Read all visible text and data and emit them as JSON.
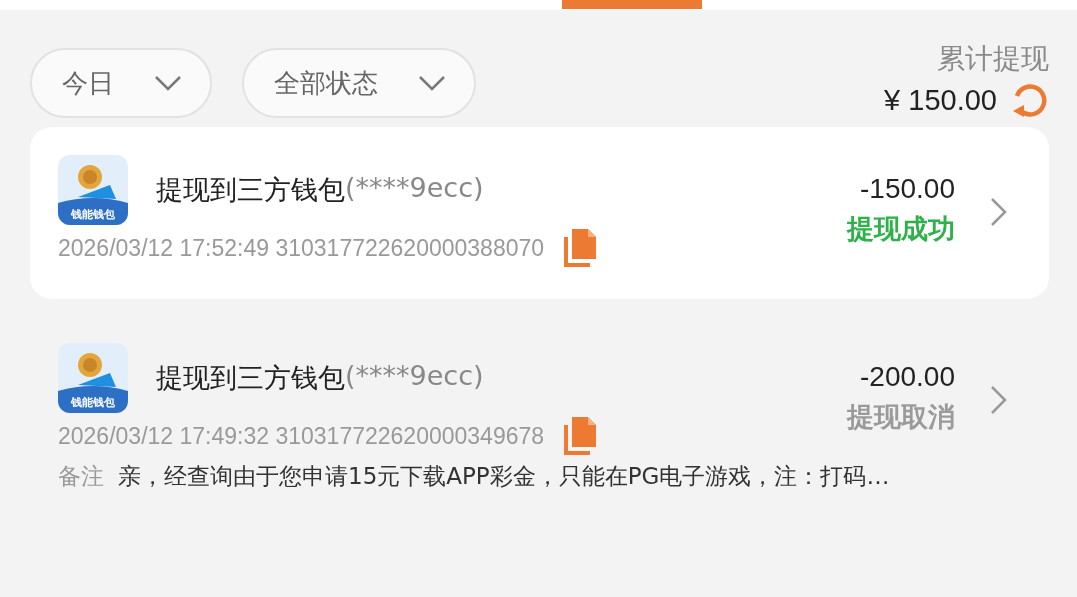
{
  "filters": [
    {
      "label": "今日"
    },
    {
      "label": "全部状态"
    }
  ],
  "summary": {
    "label": "累计提现",
    "amount": "¥ 150.00"
  },
  "records": [
    {
      "logo_text": "钱能钱包",
      "title": "提现到三方钱包",
      "account": "(****9ecc)",
      "time": "2026/03/12 17:52:49",
      "order_no": "310317722620000388070",
      "amount": "-150.00",
      "status": "提现成功",
      "color": "#2fb14a",
      "highlighted": true
    },
    {
      "logo_text": "钱能钱包",
      "title": "提现到三方钱包",
      "account": "(****9ecc)",
      "time": "2026/03/12 17:49:32",
      "order_no": "310317722620000349678",
      "amount": "-200.00",
      "status": "提现取消",
      "color": "#9a9a9a",
      "highlighted": false,
      "note_label": "备注",
      "note": "亲，经查询由于您申请15元下载APP彩金，只能在PG电子游戏，注：打码…"
    }
  ]
}
